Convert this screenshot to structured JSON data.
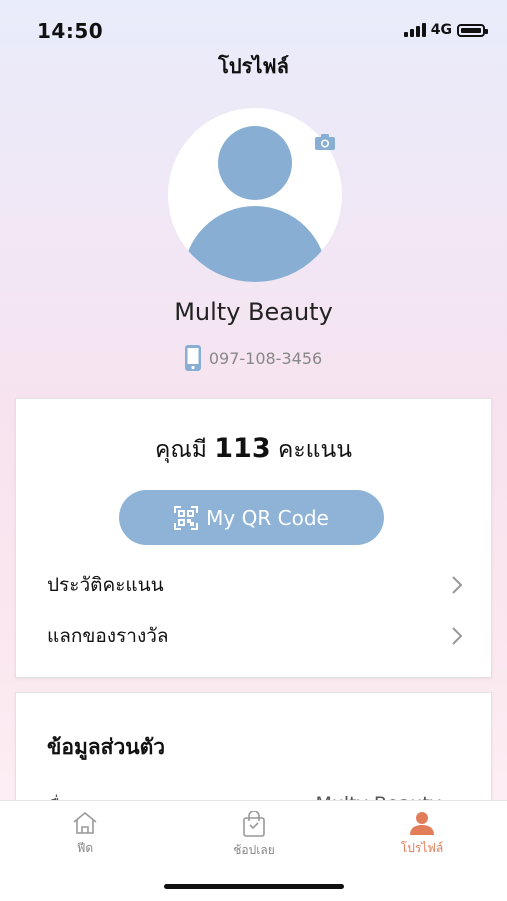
{
  "status_bar": {
    "time": "14:50",
    "network": "4G"
  },
  "header": {
    "title": "โปรไฟล์"
  },
  "profile": {
    "name": "Multy Beauty",
    "phone": "097-108-3456"
  },
  "points_card": {
    "prefix": "คุณมี",
    "points": "113",
    "suffix": "คะแนน",
    "qr_button_label": "My QR Code",
    "menu": [
      {
        "label": "ประวัติคะแนน"
      },
      {
        "label": "แลกของรางวัล"
      }
    ]
  },
  "personal_info": {
    "heading": "ข้อมูลส่วนตัว",
    "rows": [
      {
        "label": "ชื่อ",
        "value": "Multy Beauty"
      }
    ]
  },
  "tabbar": {
    "tabs": [
      {
        "label": "ฟีด",
        "icon": "home-icon"
      },
      {
        "label": "ช้อปเลย",
        "icon": "shopping-bag-icon"
      },
      {
        "label": "โปรไฟล์",
        "icon": "person-icon",
        "active": true
      }
    ]
  },
  "colors": {
    "accent_blue": "#8eb3d6",
    "avatar_blue": "#88afd3",
    "active_tab": "#e17e59"
  }
}
